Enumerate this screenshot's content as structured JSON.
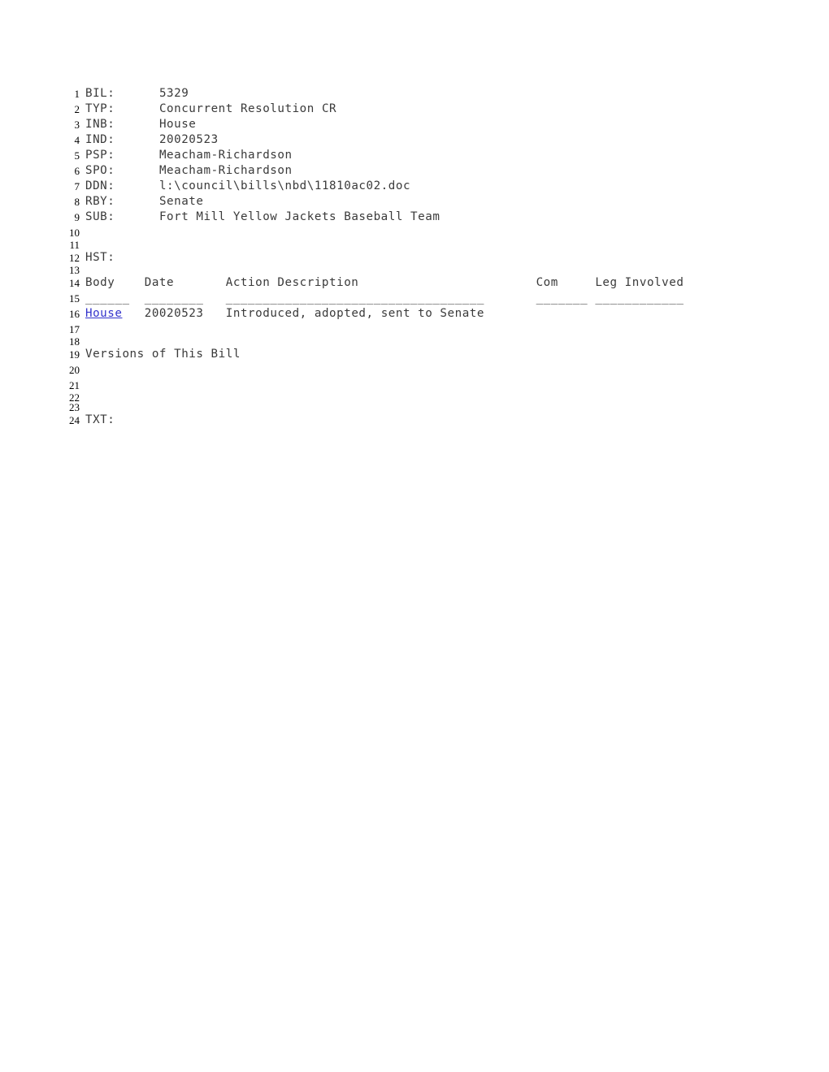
{
  "document": {
    "title": "Bill 5329 - Concurrent Resolution",
    "link_color": "#3333cc",
    "text_color": "#3a3a3a",
    "background_color": "#ffffff"
  },
  "fields": {
    "bil_label": "BIL:",
    "bil_value": "5329",
    "typ_label": "TYP:",
    "typ_value": "Concurrent Resolution CR",
    "inb_label": "INB:",
    "inb_value": "House",
    "ind_label": "IND:",
    "ind_value": "20020523",
    "psp_label": "PSP:",
    "psp_value": "Meacham-Richardson",
    "spo_label": "SPO:",
    "spo_value": "Meacham-Richardson",
    "ddn_label": "DDN:",
    "ddn_value": "l:\\council\\bills\\nbd\\11810ac02.doc",
    "rby_label": "RBY:",
    "rby_value": "Senate",
    "sub_label": "SUB:",
    "sub_value": "Fort Mill Yellow Jackets Baseball Team",
    "hst_label": "HST:",
    "txt_label": "TXT:"
  },
  "history_table": {
    "headers": {
      "body": "Body",
      "date": "Date",
      "action": "Action Description",
      "com": "Com",
      "leg": "Leg Involved"
    },
    "rules": {
      "body": "______",
      "date": "________",
      "action": "___________________________",
      "com": "_______",
      "leg": "____________"
    },
    "rows": [
      {
        "body": "House",
        "body_is_link": true,
        "date": "20020523",
        "action": "Introduced, adopted, sent to Senate",
        "com": "",
        "leg": ""
      }
    ]
  },
  "versions": {
    "heading": "Versions of This Bill"
  },
  "lines": [
    {
      "n": "1",
      "kind": "field",
      "label": "BIL:",
      "value": "5329"
    },
    {
      "n": "2",
      "kind": "field",
      "label": "TYP:",
      "value": "Concurrent Resolution CR"
    },
    {
      "n": "3",
      "kind": "field",
      "label": "INB:",
      "value": "House"
    },
    {
      "n": "4",
      "kind": "field",
      "label": "IND:",
      "value": "20020523"
    },
    {
      "n": "5",
      "kind": "field",
      "label": "PSP:",
      "value": "Meacham-Richardson"
    },
    {
      "n": "6",
      "kind": "field",
      "label": "SPO:",
      "value": "Meacham-Richardson"
    },
    {
      "n": "7",
      "kind": "field",
      "label": "DDN:",
      "value": "l:\\council\\bills\\nbd\\11810ac02.doc"
    },
    {
      "n": "8",
      "kind": "field",
      "label": "RBY:",
      "value": "Senate"
    },
    {
      "n": "9",
      "kind": "field",
      "label": "SUB:",
      "value": "Fort Mill Yellow Jackets Baseball Team"
    },
    {
      "n": "10",
      "kind": "blank",
      "text": ""
    },
    {
      "n": "11",
      "kind": "blank",
      "text": ""
    },
    {
      "n": "12",
      "kind": "text",
      "text": "HST:"
    },
    {
      "n": "13",
      "kind": "blank",
      "text": ""
    },
    {
      "n": "14",
      "kind": "header",
      "text": "Body    Date       Action Description                        Com     Leg Involved"
    },
    {
      "n": "15",
      "kind": "rule",
      "text": "______  ________   ___________________________________       _______ ____________"
    },
    {
      "n": "16",
      "kind": "row",
      "text": "House   20020523   Introduced, adopted, sent to Senate"
    },
    {
      "n": "17",
      "kind": "blank",
      "text": ""
    },
    {
      "n": "18",
      "kind": "blank",
      "text": ""
    },
    {
      "n": "19",
      "kind": "text",
      "text": "Versions of This Bill"
    },
    {
      "n": "20",
      "kind": "blank",
      "text": ""
    },
    {
      "n": "21",
      "kind": "blank",
      "text": ""
    },
    {
      "n": "22",
      "kind": "blank",
      "text": ""
    },
    {
      "n": "23",
      "kind": "blank",
      "text": ""
    },
    {
      "n": "24",
      "kind": "text",
      "text": "TXT:"
    }
  ]
}
